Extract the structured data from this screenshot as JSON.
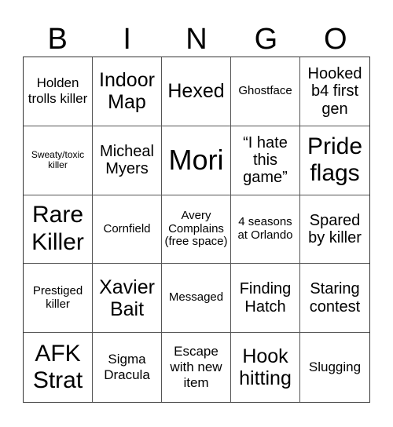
{
  "header": [
    "B",
    "I",
    "N",
    "G",
    "O"
  ],
  "cells": [
    {
      "text": "Holden trolls killer",
      "size": "fs-m"
    },
    {
      "text": "Indoor Map",
      "size": "fs-xl"
    },
    {
      "text": "Hexed",
      "size": "fs-xl"
    },
    {
      "text": "Ghostface",
      "size": "fs-s"
    },
    {
      "text": "Hooked b4 first gen",
      "size": "fs-l"
    },
    {
      "text": "Sweaty/toxic killer",
      "size": "fs-xs"
    },
    {
      "text": "Micheal Myers",
      "size": "fs-l"
    },
    {
      "text": "Mori",
      "size": "fs-xxxl"
    },
    {
      "text": "“I hate this game”",
      "size": "fs-l"
    },
    {
      "text": "Pride flags",
      "size": "fs-xxl"
    },
    {
      "text": "Rare Killer",
      "size": "fs-xxl"
    },
    {
      "text": "Cornfield",
      "size": "fs-s"
    },
    {
      "text": "Avery Complains (free space)",
      "size": "fs-s"
    },
    {
      "text": "4 seasons at Orlando",
      "size": "fs-s"
    },
    {
      "text": "Spared by killer",
      "size": "fs-l"
    },
    {
      "text": "Prestiged killer",
      "size": "fs-s"
    },
    {
      "text": "Xavier Bait",
      "size": "fs-xl"
    },
    {
      "text": "Messaged",
      "size": "fs-s"
    },
    {
      "text": "Finding Hatch",
      "size": "fs-l"
    },
    {
      "text": "Staring contest",
      "size": "fs-l"
    },
    {
      "text": "AFK Strat",
      "size": "fs-xxl"
    },
    {
      "text": "Sigma Dracula",
      "size": "fs-m"
    },
    {
      "text": "Escape with new item",
      "size": "fs-m"
    },
    {
      "text": "Hook hitting",
      "size": "fs-xl"
    },
    {
      "text": "Slugging",
      "size": "fs-m"
    }
  ]
}
